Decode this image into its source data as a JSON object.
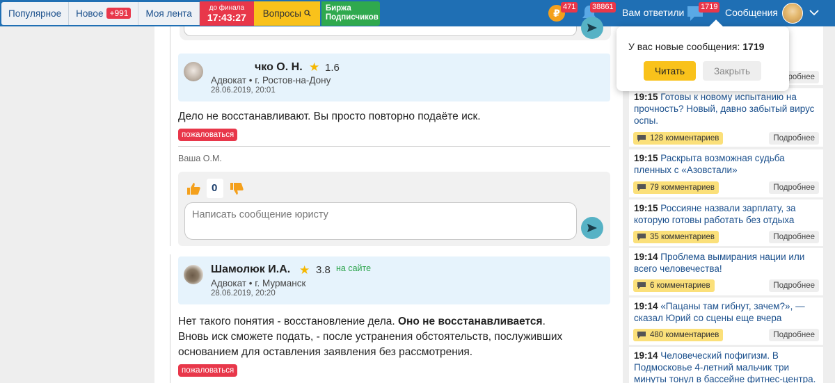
{
  "topbar": {
    "tabs": [
      {
        "label": "Популярное"
      },
      {
        "label": "Новое",
        "badge": "+991"
      },
      {
        "label": "Моя лента"
      }
    ],
    "timer": {
      "caption": "до финала",
      "time": "17:43:27"
    },
    "questions_label": "Вопросы",
    "exchange": {
      "line1": "Биржа",
      "line2": "Подписчиков"
    },
    "rub_symbol": "₽",
    "rub_badge": "471",
    "bell_badge": "38861",
    "answered_label": "Вам ответили",
    "chat_badge": "1719",
    "messages_label": "Сообщения"
  },
  "answers": [
    {
      "name": "чко О. Н.",
      "rating": "1.6",
      "meta": "Адвокат • г. Ростов-на-Дону",
      "date": "28.06.2019, 20:01",
      "text": "Дело не восстанавливают. Вы просто повторно подаёте иск.",
      "complain": "пожаловаться",
      "signature": "Ваша О.М.",
      "votes": "0",
      "placeholder": "Написать сообщение юристу"
    },
    {
      "name": "Шамолюк И.А.",
      "rating": "3.8",
      "online": "на сайте",
      "meta": "Адвокат • г. Мурманск",
      "date": "28.06.2019, 20:20",
      "text_before": "Нет такого понятия - восстановление дела. ",
      "text_bold": "Оно не восстанавливается",
      "text_after": ". Вновь иск сможете подать, - после устранения обстоятельств, послуживших основанием для оставления заявления без рассмотрения.",
      "complain": "пожаловаться"
    }
  ],
  "popup": {
    "text": "У вас новые сообщения:",
    "count": "1719",
    "read_label": "Читать",
    "close_label": "Закрыть"
  },
  "news": {
    "top_more": "Подробнее",
    "items": [
      {
        "time": "19:15",
        "title": "Готовы к новому испытанию на прочность? Новый, давно забытый вирус оспы.",
        "comments": "128 комментариев",
        "more": "Подробнее"
      },
      {
        "time": "19:15",
        "title": "Раскрыта возможная судьба пленных с «Азовстали»",
        "comments": "79 комментариев",
        "more": "Подробнее"
      },
      {
        "time": "19:15",
        "title": "Россияне назвали зарплату, за которую готовы работать без отдыха",
        "comments": "35 комментариев",
        "more": "Подробнее"
      },
      {
        "time": "19:14",
        "title": "Проблема вымирания нации или всего человечества!",
        "comments": "6 комментариев",
        "more": "Подробнее"
      },
      {
        "time": "19:14",
        "title": "«Пацаны там гибнут, зачем?», — сказал Юрий со сцены еще вчера",
        "comments": "480 комментариев",
        "more": "Подробнее"
      },
      {
        "time": "19:14",
        "title": "Человеческий пофигизм. В Подмосковье 4-летний мальчик три минуты тонул в бассейне фитнес-центра.",
        "comments": "",
        "more": ""
      }
    ]
  },
  "colors": {
    "brand": "#1f6fb4",
    "accent": "#f9c21b",
    "alert": "#e8374a",
    "green": "#2fa94e"
  }
}
